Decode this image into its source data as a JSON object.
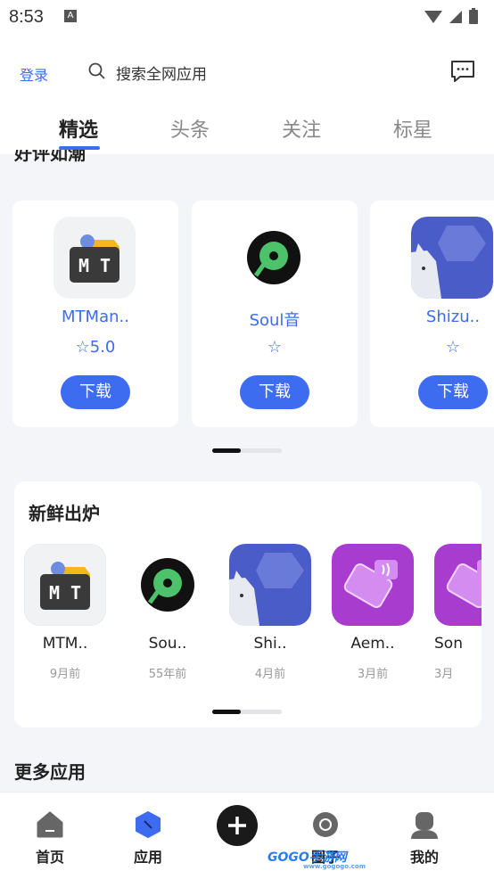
{
  "status_bar": {
    "time": "8:53",
    "notification_glyph": "A"
  },
  "header": {
    "login_label": "登录",
    "search_placeholder": "搜索全网应用",
    "tabs": [
      "精选",
      "头条",
      "关注",
      "标星"
    ],
    "active_tab": "精选"
  },
  "top_rated": {
    "title": "好评如潮",
    "apps": [
      {
        "name": "MTMan..",
        "rating": "5.0",
        "download_label": "下载",
        "icon": "mt-manager-icon"
      },
      {
        "name": "Soul音",
        "rating": "",
        "download_label": "下载",
        "icon": "vinyl-disc-icon"
      },
      {
        "name": "Shizu..",
        "rating": "",
        "download_label": "下载",
        "icon": "shizuku-cat-icon"
      }
    ]
  },
  "fresh": {
    "title": "新鲜出炉",
    "apps": [
      {
        "name": "MTM..",
        "time": "9月前",
        "icon": "mt-manager-icon"
      },
      {
        "name": "Sou..",
        "time": "55年前",
        "icon": "vinyl-disc-icon"
      },
      {
        "name": "Shi..",
        "time": "4月前",
        "icon": "shizuku-cat-icon"
      },
      {
        "name": "Aem..",
        "time": "3月前",
        "icon": "nfc-card-icon"
      },
      {
        "name": "Son",
        "time": "3月",
        "icon": "nfc-card-icon"
      }
    ]
  },
  "more_apps": {
    "title": "更多应用"
  },
  "bottom_nav": {
    "items": [
      {
        "label": "首页",
        "icon": "home-icon"
      },
      {
        "label": "应用",
        "icon": "apps-icon"
      },
      {
        "label": "圈子",
        "icon": "community-icon"
      },
      {
        "label": "我的",
        "icon": "profile-icon"
      }
    ],
    "add_icon": "plus-icon"
  },
  "watermark": {
    "text": "GOGO手游网",
    "url_text": "www.gogogo.com"
  },
  "colors": {
    "accent": "#3d6cf0",
    "background": "#f4f5f9"
  }
}
